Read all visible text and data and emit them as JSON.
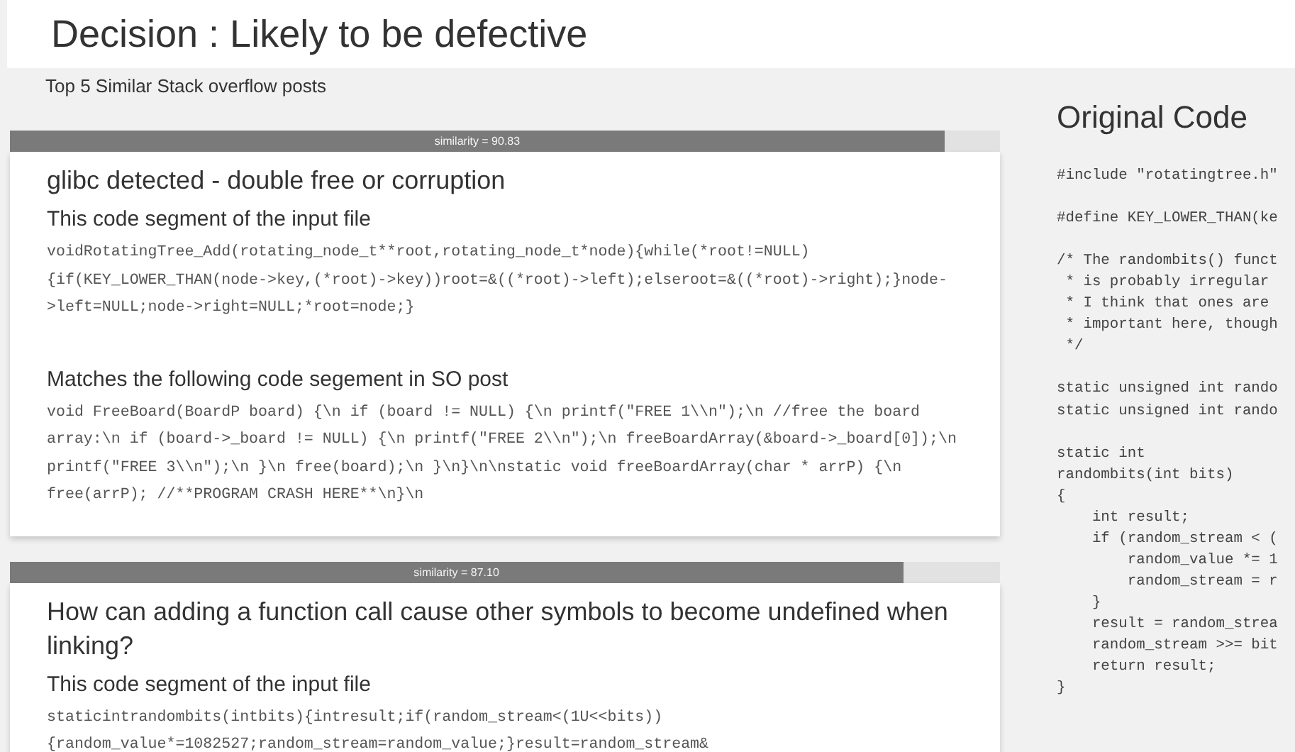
{
  "header": {
    "title": "Decision : Likely to be defective",
    "subtitle": "Top 5 Similar Stack overflow posts"
  },
  "posts": [
    {
      "similarity": "similarity = 90.83",
      "level": 0.944,
      "title": "glibc detected - double free or corruption",
      "input_heading": "This code segment of the input file",
      "input_code": "voidRotatingTree_Add(rotating_node_t**root,rotating_node_t*node){while(*root!=NULL){if(KEY_LOWER_THAN(node->key,(*root)->key))root=&((*root)->left);elseroot=&((*root)->right);}node->left=NULL;node->right=NULL;*root=node;}",
      "match_heading": "Matches the following code segement in SO post",
      "match_code": "void FreeBoard(BoardP board) {\\n if (board != NULL) {\\n printf(\"FREE 1\\\\n\");\\n //free the board array:\\n if (board->_board != NULL) {\\n printf(\"FREE 2\\\\n\");\\n freeBoardArray(&board->_board[0]);\\n printf(\"FREE 3\\\\n\");\\n }\\n free(board);\\n }\\n}\\n\\nstatic void freeBoardArray(char * arrP) {\\n free(arrP); //**PROGRAM CRASH HERE**\\n}\\n"
    },
    {
      "similarity": "similarity = 87.10",
      "level": 0.902,
      "title": "How can adding a function call cause other symbols to become undefined when linking?",
      "input_heading": "This code segment of the input file",
      "input_code": "staticintrandombits(intbits){intresult;if(random_stream<(1U<<bits)){random_value*=1082527;random_stream=random_value;}result=random_stream&"
    }
  ],
  "original_code": {
    "title": "Original Code",
    "code": "#include \"rotatingtree.h\"\n\n#define KEY_LOWER_THAN(ke\n\n/* The randombits() funct\n * is probably irregular\n * I think that ones are\n * important here, though\n */\n\nstatic unsigned int rando\nstatic unsigned int rando\n\nstatic int\nrandombits(int bits)\n{\n    int result;\n    if (random_stream < (\n        random_value *= 1\n        random_stream = r\n    }\n    result = random_strea\n    random_stream >>= bit\n    return result;\n}"
  }
}
